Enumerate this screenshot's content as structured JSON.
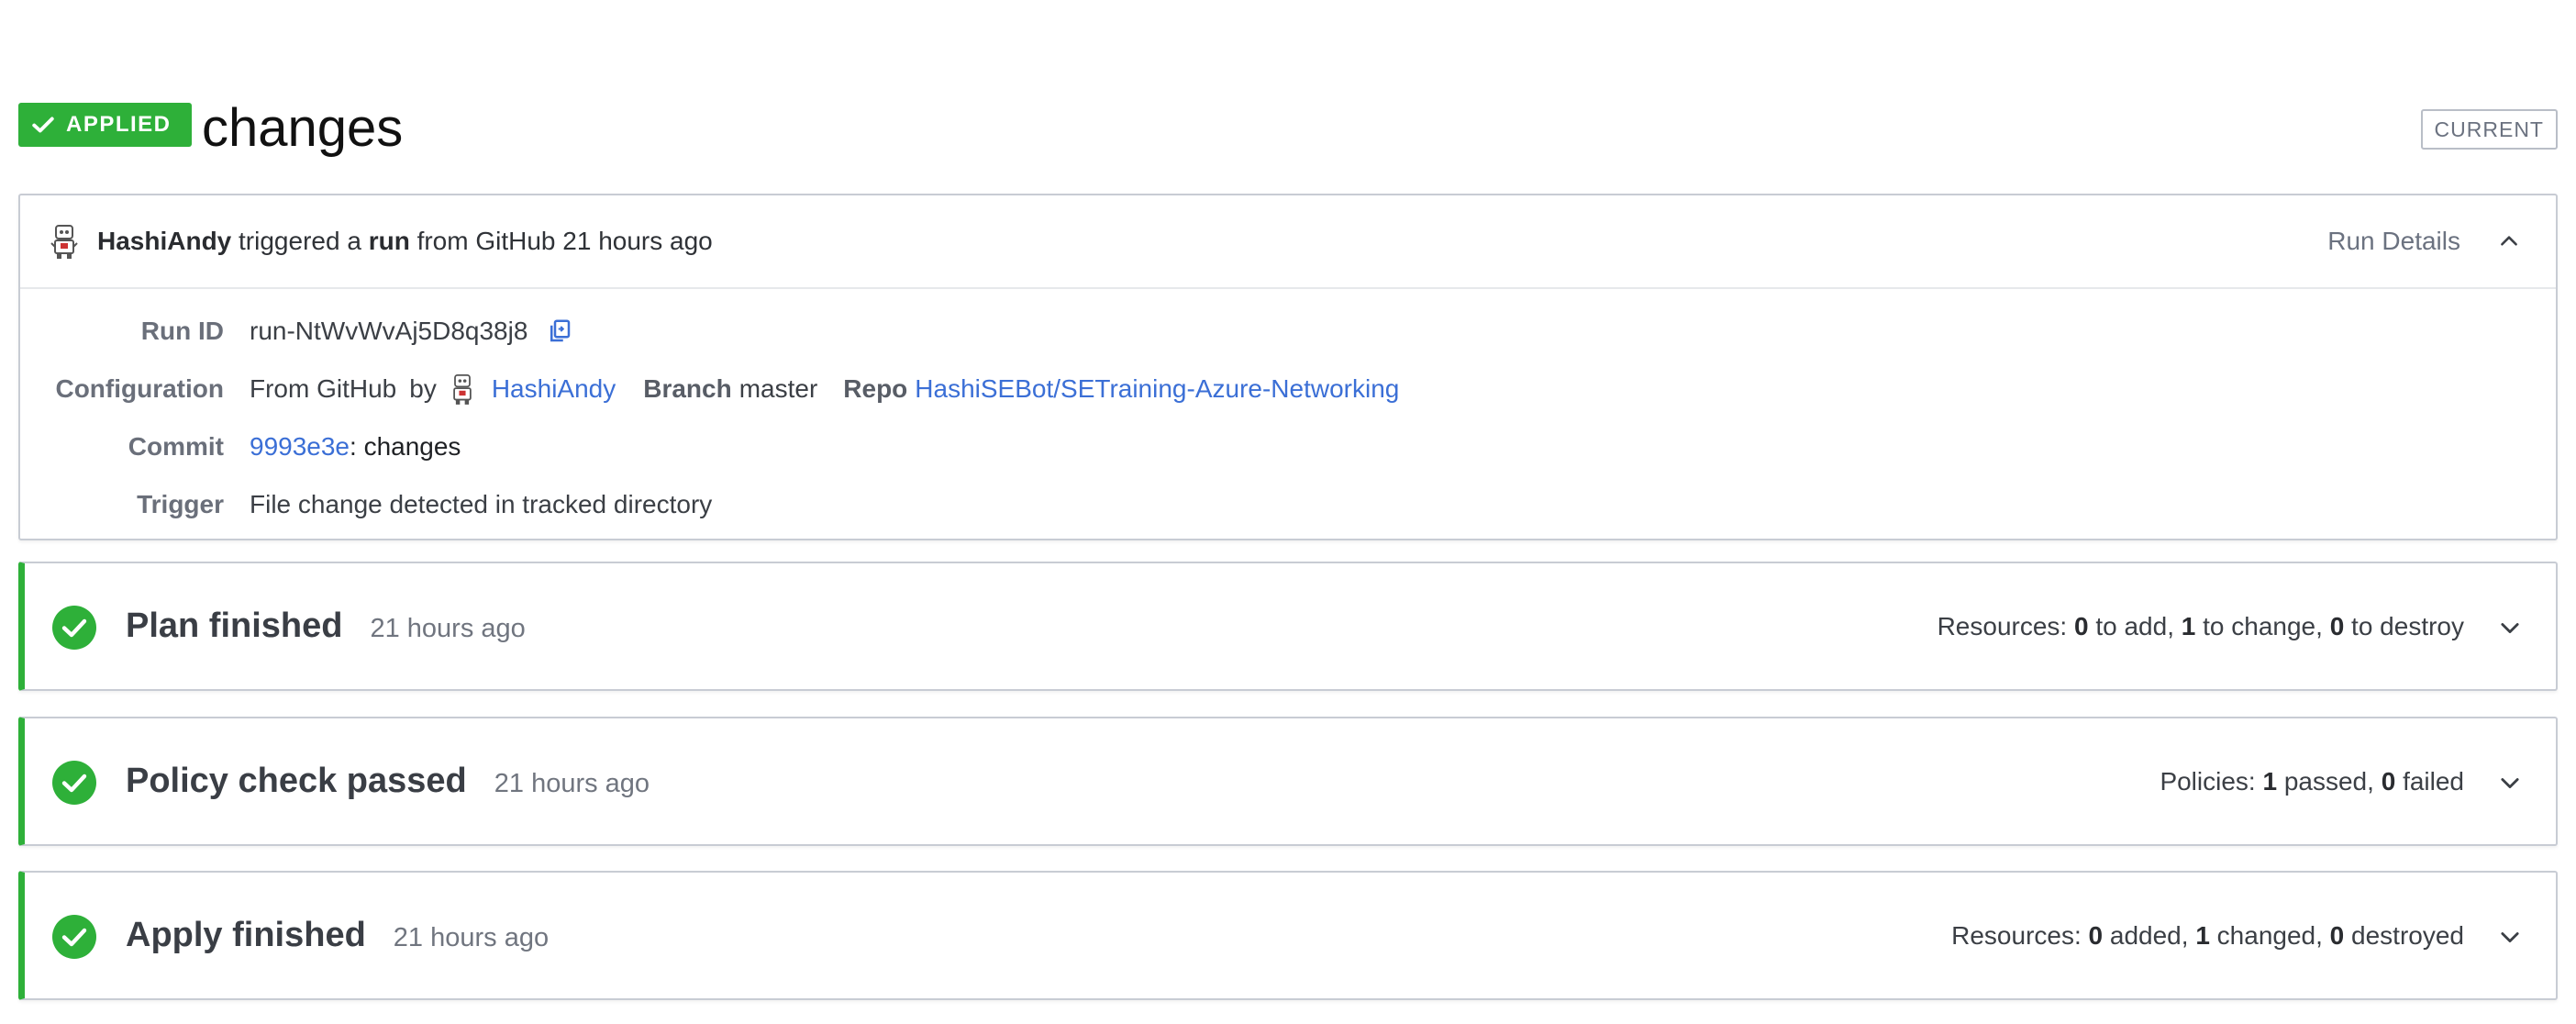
{
  "header": {
    "status_badge": "APPLIED",
    "title": "changes",
    "current_badge": "CURRENT"
  },
  "run": {
    "user": "HashiAndy",
    "triggered_text": "triggered a",
    "run_word": "run",
    "from_text": "from GitHub 21 hours ago",
    "details_toggle": "Run Details",
    "rows": {
      "run_id_label": "Run ID",
      "run_id_value": "run-NtWvWvAj5D8q38j8",
      "configuration_label": "Configuration",
      "configuration_from": "From GitHub",
      "configuration_by": "by",
      "configuration_user": "HashiAndy",
      "branch_label": "Branch",
      "branch_value": "master",
      "repo_label": "Repo",
      "repo_value": "HashiSEBot/SETraining-Azure-Networking",
      "commit_label": "Commit",
      "commit_sha": "9993e3e",
      "commit_message": ": changes",
      "trigger_label": "Trigger",
      "trigger_value": "File change detected in tracked directory"
    }
  },
  "steps": [
    {
      "title": "Plan finished",
      "time": "21 hours ago",
      "summary_prefix": "Resources:",
      "n1": "0",
      "t1": "to add,",
      "n2": "1",
      "t2": "to change,",
      "n3": "0",
      "t3": "to destroy"
    },
    {
      "title": "Policy check passed",
      "time": "21 hours ago",
      "summary_prefix": "Policies:",
      "n1": "1",
      "t1": "passed,",
      "n2": "0",
      "t2": "failed"
    },
    {
      "title": "Apply finished",
      "time": "21 hours ago",
      "summary_prefix": "Resources:",
      "n1": "0",
      "t1": "added,",
      "n2": "1",
      "t2": "changed,",
      "n3": "0",
      "t3": "destroyed"
    }
  ],
  "colors": {
    "success": "#2eb039",
    "link": "#3b6fd6",
    "border": "#c8ccd4"
  },
  "icons": {
    "badge": "check-icon",
    "copy": "copy-icon",
    "collapse": "chevron-up-icon",
    "expand": "chevron-down-icon",
    "step_status": "check-circle-icon",
    "avatar": "robot-avatar-icon"
  }
}
